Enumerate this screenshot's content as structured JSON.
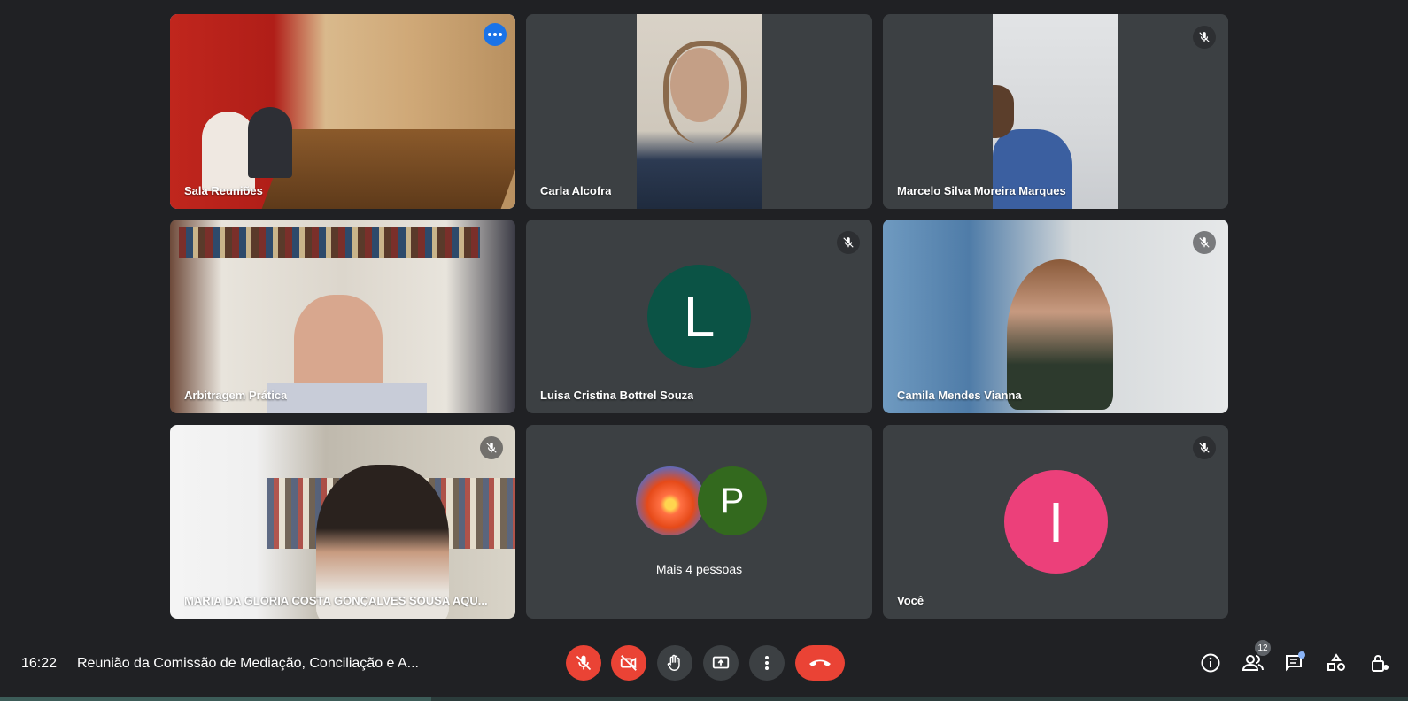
{
  "participants": [
    {
      "name": "Sala Reuniões",
      "type": "video"
    },
    {
      "name": "Carla Alcofra",
      "type": "video"
    },
    {
      "name": "Marcelo Silva Moreira Marques",
      "type": "video",
      "muted": true
    },
    {
      "name": "Arbitragem Prática",
      "type": "video"
    },
    {
      "name": "Luisa Cristina Bottrel Souza",
      "type": "avatar",
      "initial": "L",
      "color": "#0b5345",
      "muted": true
    },
    {
      "name": "Camila Mendes Vianna",
      "type": "video",
      "muted": true
    },
    {
      "name": "MARIA DA GLORIA COSTA GONÇALVES SOUSA AQU...",
      "type": "video",
      "muted": true
    },
    {
      "more_text": "Mais 4 pessoas",
      "initial": "P",
      "color": "#33691e"
    },
    {
      "name": "Você",
      "type": "avatar",
      "initial": "I",
      "color": "#ec407a",
      "muted": true
    }
  ],
  "bottom_bar": {
    "time": "16:22",
    "meeting_title": "Reunião da Comissão de Mediação, Conciliação e A...",
    "participants_count": "12",
    "controls": [
      "mic-off",
      "camera-off",
      "raise-hand",
      "present",
      "more-options",
      "leave-call"
    ],
    "right_icons": [
      "info",
      "people",
      "chat",
      "activities",
      "host-controls"
    ]
  }
}
